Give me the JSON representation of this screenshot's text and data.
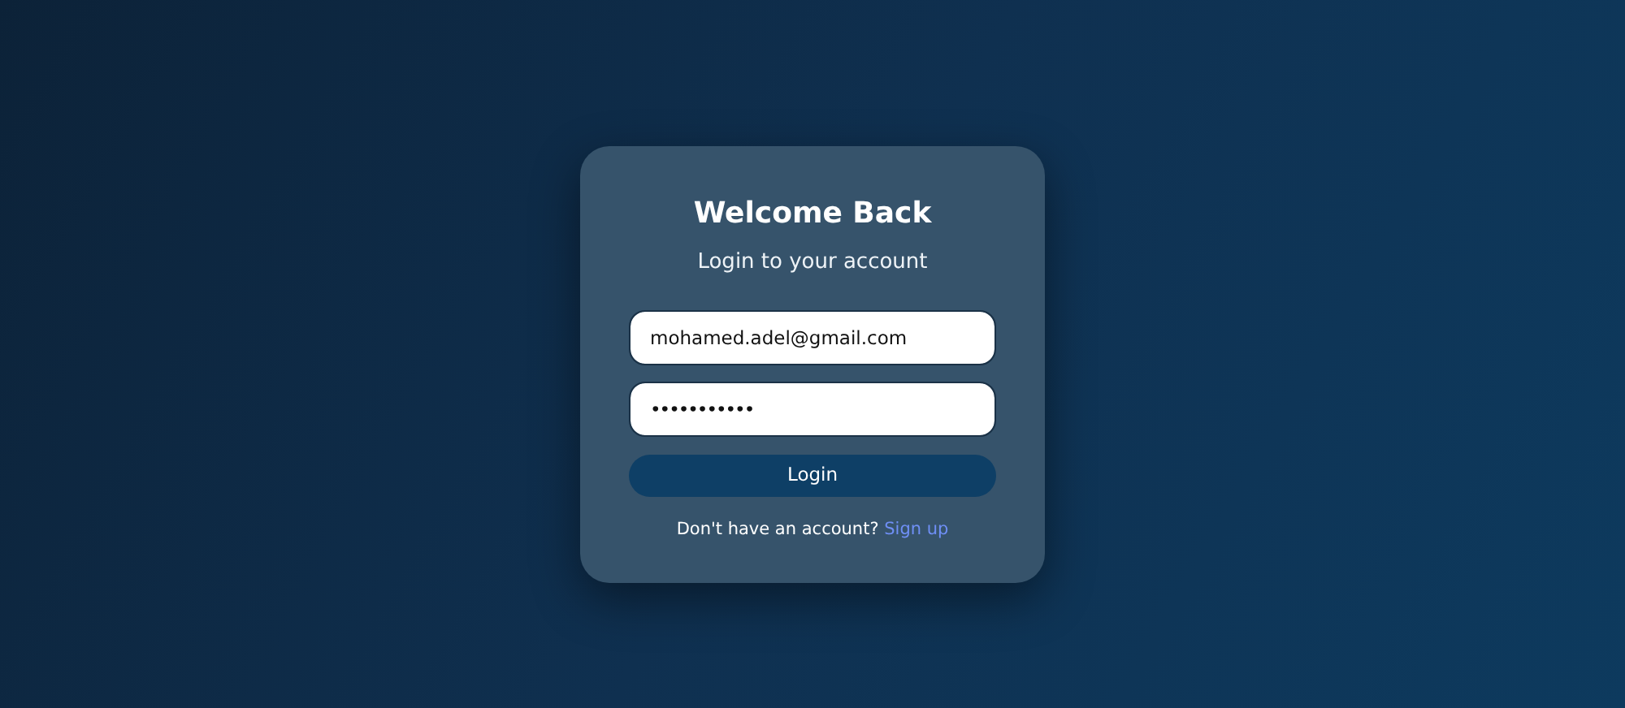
{
  "title": "Welcome Back",
  "subtitle": "Login to your account",
  "fields": [
    {
      "kind": "email",
      "value": "mohamed.adel@gmail.com"
    },
    {
      "kind": "password",
      "value": "•••••••••••"
    }
  ],
  "button": "Login",
  "footer": {
    "text": "Don't have an account?",
    "link": "Sign up"
  }
}
